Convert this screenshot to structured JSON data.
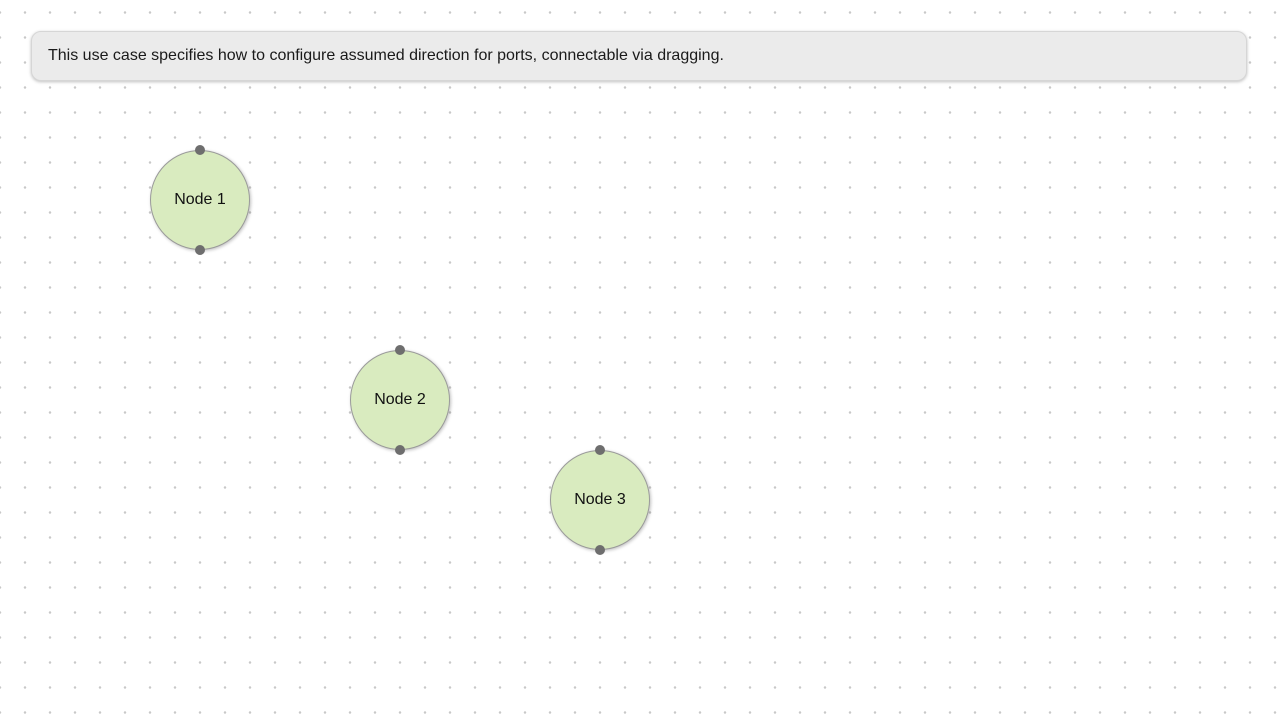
{
  "banner": {
    "text": "This use case specifies how to configure assumed direction for ports, connectable via dragging."
  },
  "nodes": [
    {
      "label": "Node 1",
      "ports": [
        "in",
        "out"
      ]
    },
    {
      "label": "Node 2",
      "ports": [
        "in",
        "out"
      ]
    },
    {
      "label": "Node 3",
      "ports": [
        "in",
        "out"
      ]
    }
  ],
  "colors": {
    "node_fill": "#d9ebbf",
    "node_stroke": "#9a9a9a",
    "port_fill": "#6e6e6e",
    "banner_bg": "#ebebeb",
    "grid_dot": "#c8c8c8"
  }
}
